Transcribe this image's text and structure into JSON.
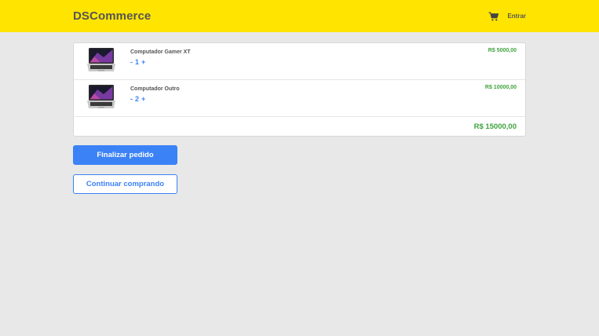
{
  "header": {
    "brand": "DSCommerce",
    "login_label": "Entrar",
    "cart_icon": "cart-icon"
  },
  "cart": {
    "items": [
      {
        "name": "Computador Gamer XT",
        "quantity": "1",
        "decrement": "-",
        "increment": "+",
        "price": "R$ 5000,00",
        "image_icon": "laptop-image"
      },
      {
        "name": "Computador Outro",
        "quantity": "2",
        "decrement": "-",
        "increment": "+",
        "price": "R$ 10000,00",
        "image_icon": "laptop-image"
      }
    ],
    "total": "R$ 15000,00"
  },
  "actions": {
    "finish_label": "Finalizar pedido",
    "continue_label": "Continuar comprando"
  },
  "colors": {
    "header_bg": "#ffe400",
    "accent": "#3b82f6",
    "price": "#3fa33f",
    "page_bg": "#e8e8e8"
  }
}
